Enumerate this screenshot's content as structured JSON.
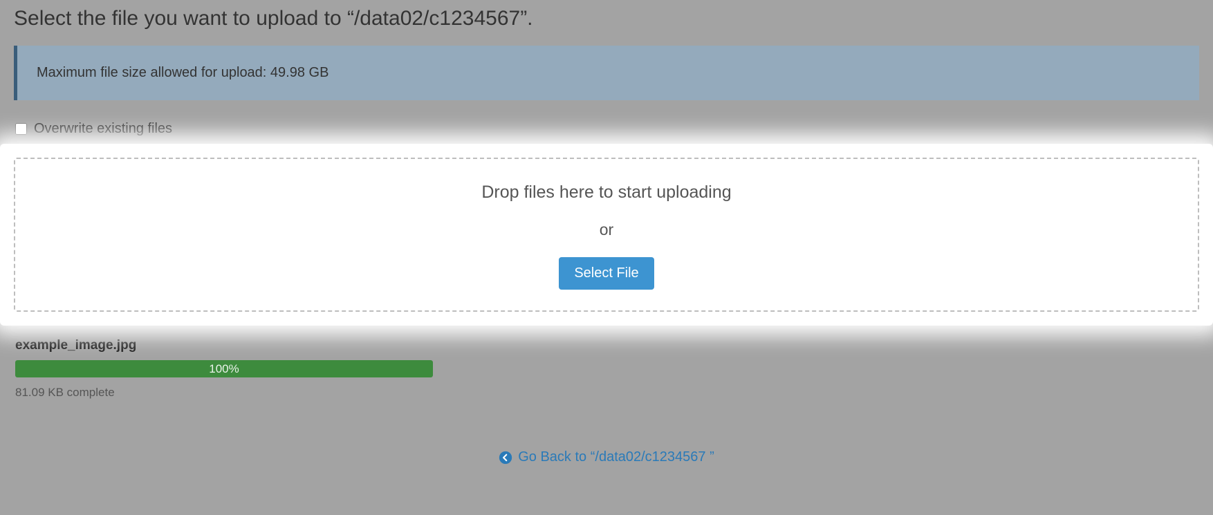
{
  "header": {
    "title": "Select the file you want to upload to “/data02/c1234567”."
  },
  "banner": {
    "text": "Maximum file size allowed for upload: 49.98 GB"
  },
  "overwrite": {
    "label": "Overwrite existing files",
    "checked": false
  },
  "dropzone": {
    "drop_text": "Drop files here to start uploading",
    "or_text": "or",
    "button_label": "Select File"
  },
  "upload": {
    "filename": "example_image.jpg",
    "progress_percent": 100,
    "progress_label": "100%",
    "status_text": "81.09 KB complete"
  },
  "footer": {
    "go_back_label": "Go Back to “/data02/c1234567 ”"
  },
  "colors": {
    "accent_blue": "#3d94d1",
    "progress_green": "#3d8b3d",
    "banner_bg": "#94aabc",
    "banner_border": "#3a5d7a"
  }
}
